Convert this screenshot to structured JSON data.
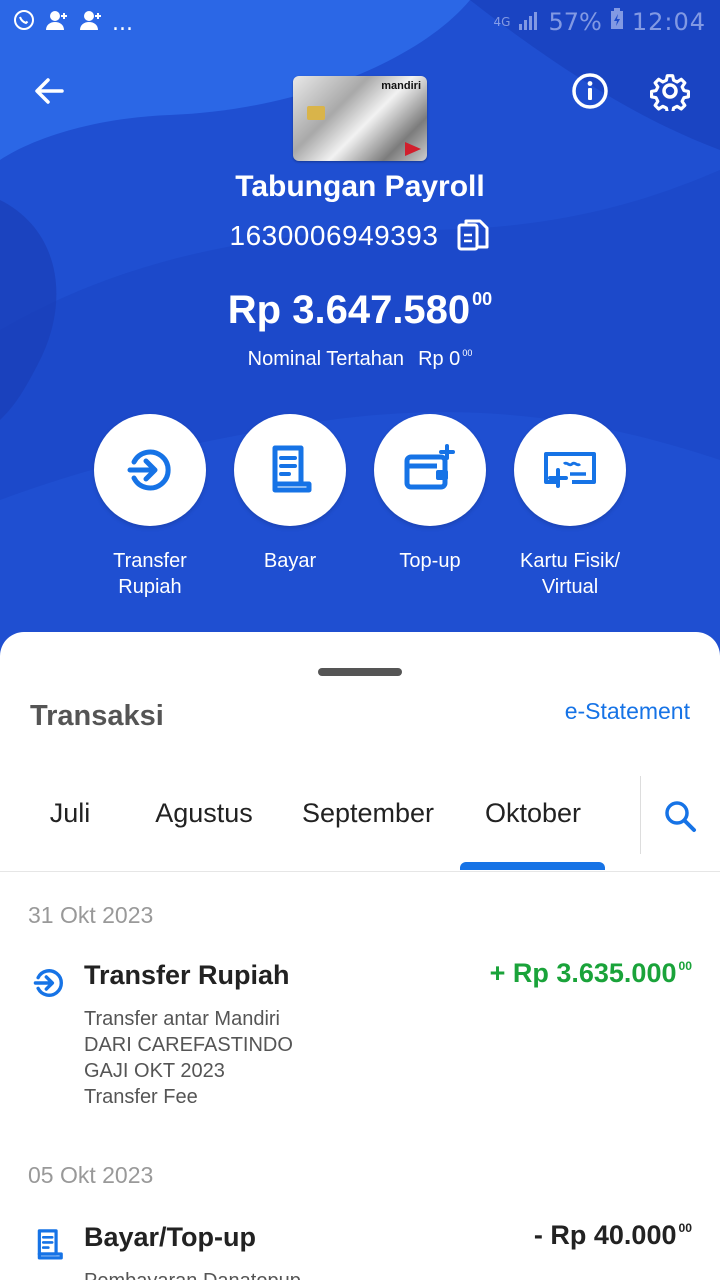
{
  "status_bar": {
    "left_icons": [
      "whatsapp-icon",
      "contact-add-icon",
      "contact-add-icon"
    ],
    "overflow": "...",
    "network": "4G",
    "battery": "57%",
    "time": "12:04"
  },
  "header": {
    "account_name": "Tabungan Payroll",
    "account_number": "1630006949393",
    "card_brand": "mandiri",
    "balance_main": "Rp 3.647.580",
    "balance_cents": "00",
    "held_label": "Nominal Tertahan",
    "held_main": "Rp 0",
    "held_cents": "00"
  },
  "actions": [
    {
      "label": "Transfer\nRupiah",
      "icon": "transfer-icon"
    },
    {
      "label": "Bayar",
      "icon": "bill-icon"
    },
    {
      "label": "Top-up",
      "icon": "wallet-topup-icon"
    },
    {
      "label": "Kartu Fisik/\nVirtual",
      "icon": "card-add-icon"
    }
  ],
  "transactions_panel": {
    "title": "Transaksi",
    "estatement_link": "e-Statement",
    "tabs": [
      "Juli",
      "Agustus",
      "September",
      "Oktober"
    ],
    "active_tab": "Oktober"
  },
  "groups": [
    {
      "date": "31 Okt 2023",
      "items": [
        {
          "title": "Transfer Rupiah",
          "icon": "transfer-icon",
          "desc": [
            "Transfer antar Mandiri",
            "DARI CAREFASTINDO",
            "GAJI OKT 2023",
            "Transfer Fee"
          ],
          "amount_main": "+ Rp 3.635.000",
          "amount_cents": "00",
          "direction": "credit"
        }
      ]
    },
    {
      "date": "05 Okt 2023",
      "items": [
        {
          "title": "Bayar/Top-up",
          "icon": "bill-icon",
          "desc": [
            "Pembayaran Danatopup"
          ],
          "amount_main": "- Rp 40.000",
          "amount_cents": "00",
          "direction": "debit"
        }
      ]
    }
  ],
  "colors": {
    "hero_bg": "#1f4fd1",
    "accent": "#1673e6",
    "credit": "#1aa33a"
  }
}
